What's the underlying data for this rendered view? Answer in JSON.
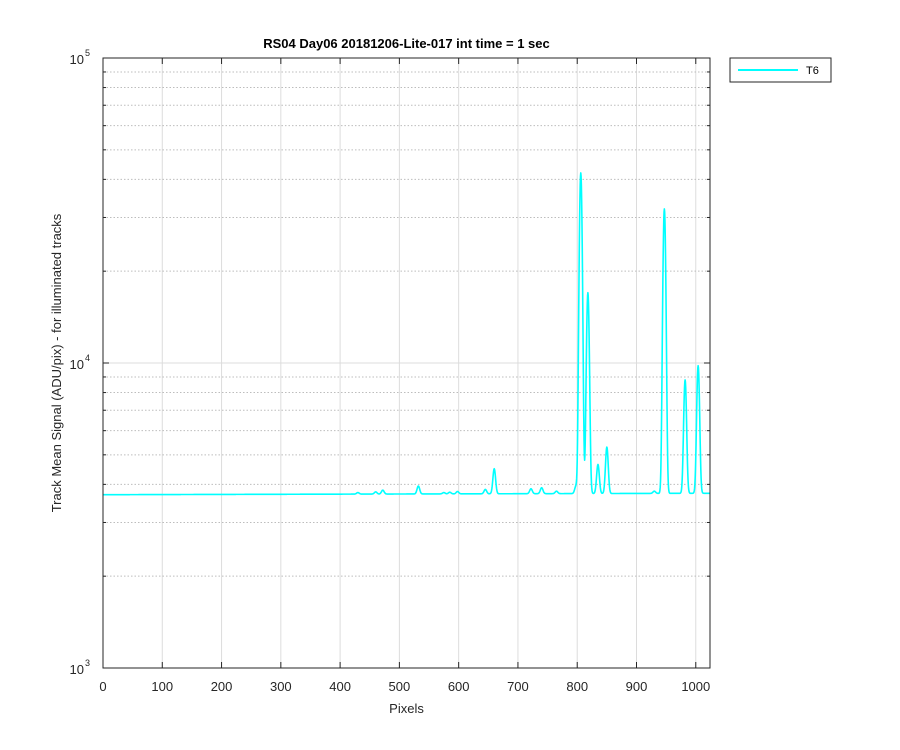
{
  "chart_data": {
    "type": "line",
    "title": "RS04 Day06 20181206-Lite-017 int time = 1 sec",
    "xlabel": "Pixels",
    "ylabel": "Track Mean Signal (ADU/pix) - for illuminated tracks",
    "xlim": [
      0,
      1024
    ],
    "ylim": [
      1000,
      100000
    ],
    "yscale": "log",
    "grid": true,
    "minor_grid": true,
    "legend_position": "outside-top-right",
    "x_ticks": [
      0,
      100,
      200,
      300,
      400,
      500,
      600,
      700,
      800,
      900,
      1000
    ],
    "x_tick_labels": [
      "0",
      "100",
      "200",
      "300",
      "400",
      "500",
      "600",
      "700",
      "800",
      "900",
      "1000"
    ],
    "y_ticks": [
      {
        "value": 1000,
        "base": "10",
        "exp": "3"
      },
      {
        "value": 10000,
        "base": "10",
        "exp": "4"
      },
      {
        "value": 100000,
        "base": "10",
        "exp": "5"
      }
    ],
    "series": [
      {
        "name": "T6",
        "color": "#00ffff",
        "baseline": 3700,
        "baseline_end": 3740,
        "peaks": [
          {
            "x": 430,
            "y": 3760
          },
          {
            "x": 460,
            "y": 3780
          },
          {
            "x": 472,
            "y": 3830
          },
          {
            "x": 532,
            "y": 3950
          },
          {
            "x": 575,
            "y": 3760
          },
          {
            "x": 585,
            "y": 3770
          },
          {
            "x": 598,
            "y": 3790
          },
          {
            "x": 645,
            "y": 3850
          },
          {
            "x": 660,
            "y": 4500
          },
          {
            "x": 722,
            "y": 3870
          },
          {
            "x": 740,
            "y": 3900
          },
          {
            "x": 765,
            "y": 3800
          },
          {
            "x": 798,
            "y": 3950
          },
          {
            "x": 806,
            "y": 42000
          },
          {
            "x": 818,
            "y": 17000
          },
          {
            "x": 835,
            "y": 4650
          },
          {
            "x": 850,
            "y": 5300
          },
          {
            "x": 930,
            "y": 3800
          },
          {
            "x": 947,
            "y": 32000
          },
          {
            "x": 982,
            "y": 8800
          },
          {
            "x": 1004,
            "y": 9800
          }
        ]
      }
    ]
  }
}
